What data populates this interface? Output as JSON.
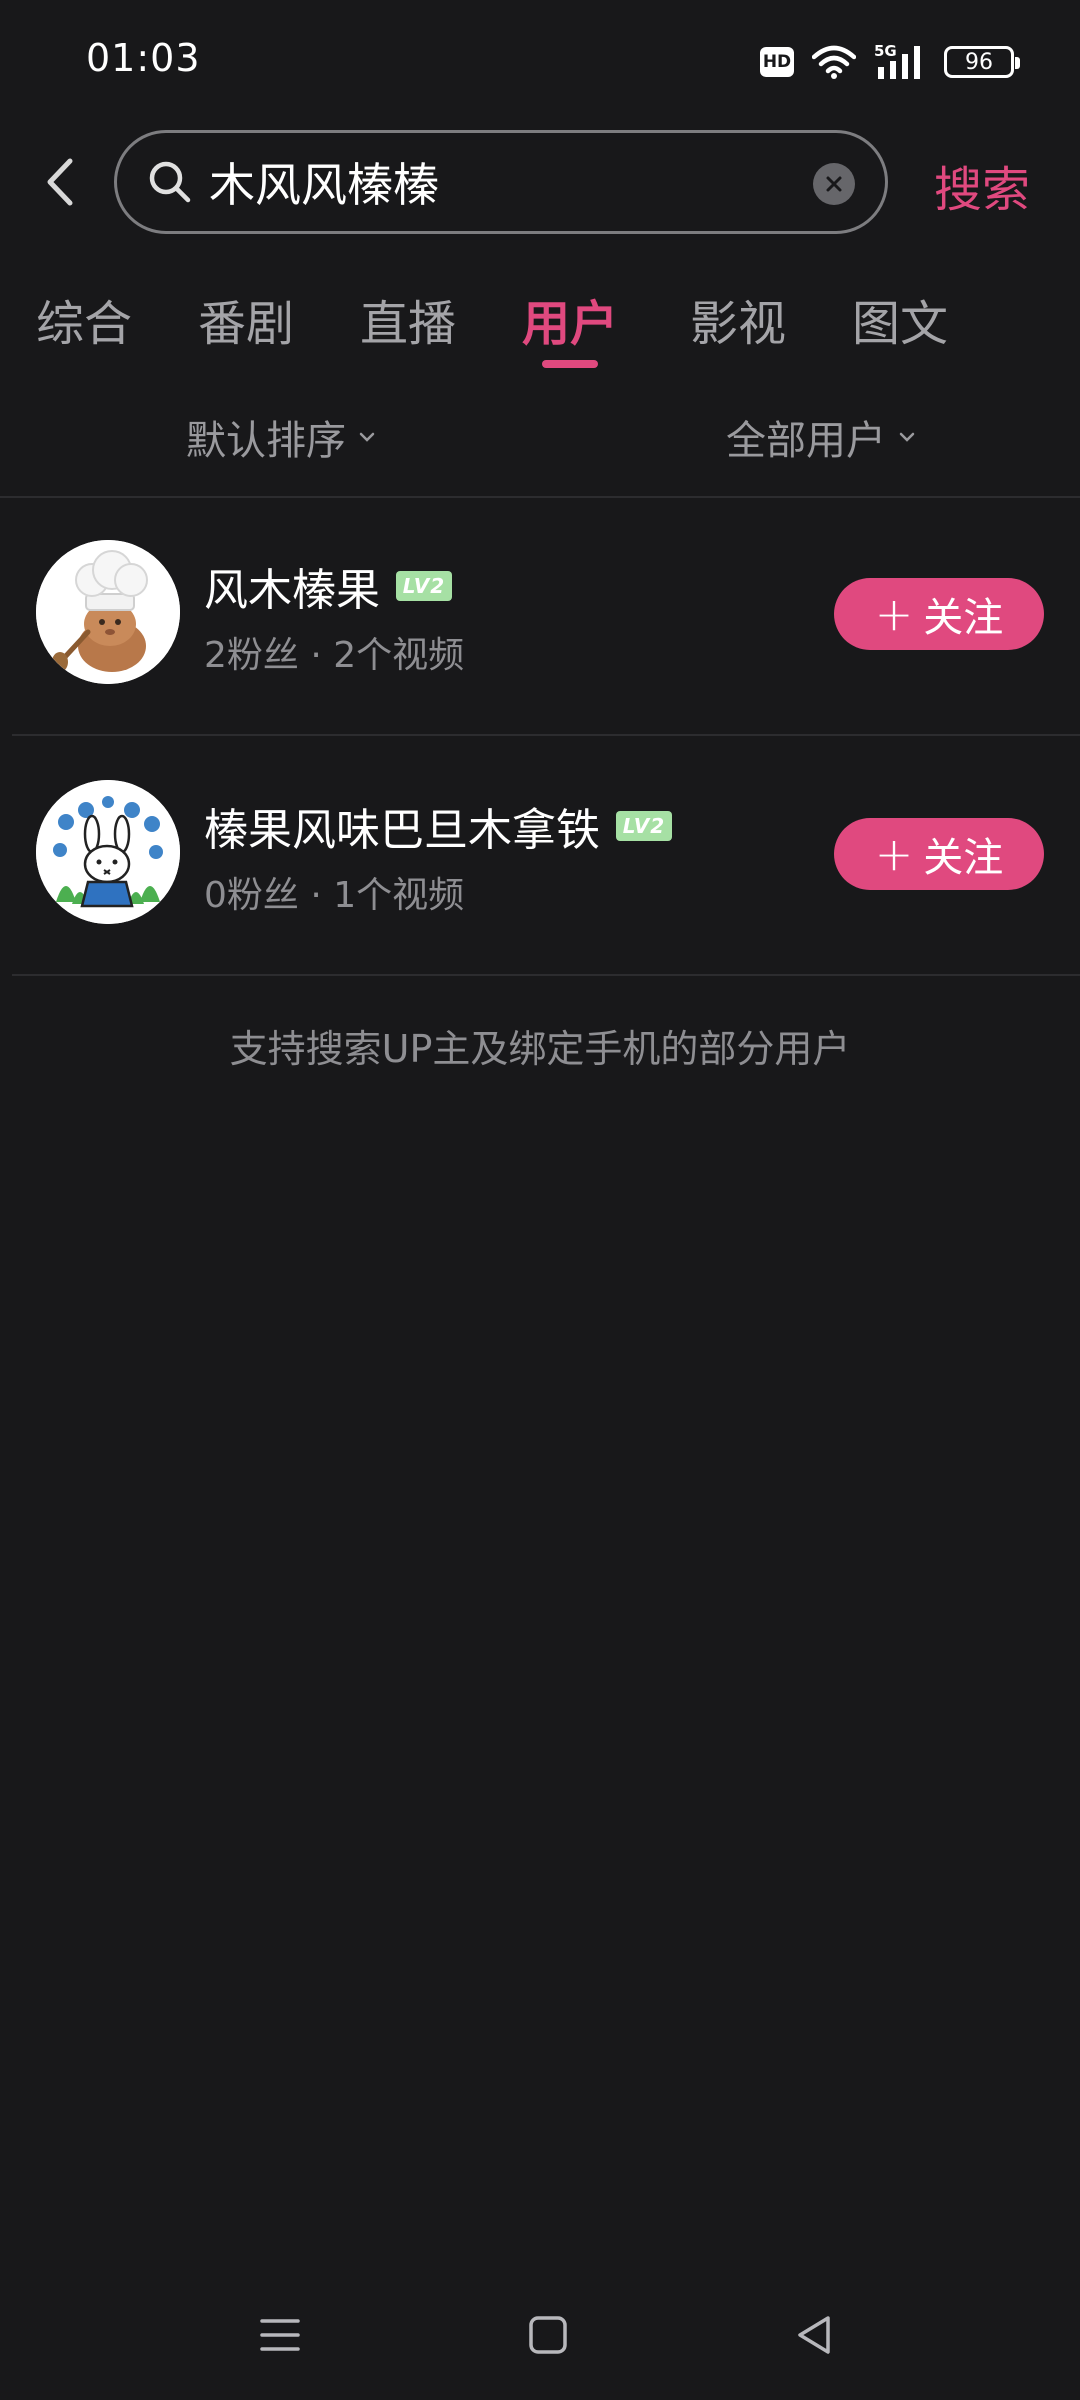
{
  "status_bar": {
    "time": "01:03",
    "hd_label": "HD",
    "network": "5G",
    "battery": "96",
    "icons": [
      "hd-icon",
      "wifi-icon",
      "signal-5g-icon",
      "battery-icon"
    ]
  },
  "search": {
    "query": "木风风榛榛",
    "submit_label": "搜索"
  },
  "tabs": [
    {
      "label": "综合",
      "active": false
    },
    {
      "label": "番剧",
      "active": false
    },
    {
      "label": "直播",
      "active": false
    },
    {
      "label": "用户",
      "active": true
    },
    {
      "label": "影视",
      "active": false
    },
    {
      "label": "图文",
      "active": false
    }
  ],
  "filters": {
    "sort_label": "默认排序",
    "user_type_label": "全部用户"
  },
  "users": [
    {
      "name": "风木榛果",
      "level": "LV2",
      "stats": "2粉丝 · 2个视频",
      "follow_label": "关注",
      "avatar": "chef-cat-avatar"
    },
    {
      "name": "榛果风味巴旦木拿铁",
      "level": "LV2",
      "stats": "0粉丝 · 1个视频",
      "follow_label": "关注",
      "avatar": "bunny-flowers-avatar"
    }
  ],
  "hint": "支持搜索UP主及绑定手机的部分用户",
  "colors": {
    "accent": "#e0497f",
    "background": "#18181a",
    "level_badge": "#a6e0a4"
  },
  "nav_bar": {
    "icons": [
      "menu-icon",
      "home-icon",
      "back-triangle-icon"
    ]
  }
}
